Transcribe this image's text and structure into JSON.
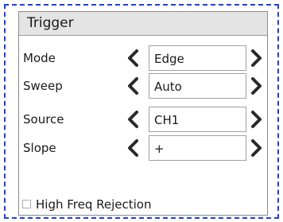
{
  "panel": {
    "title": "Trigger"
  },
  "rows": [
    {
      "label": "Mode",
      "value": "Edge"
    },
    {
      "label": "Sweep",
      "value": "Auto"
    },
    {
      "label": "Source",
      "value": "CH1"
    },
    {
      "label": "Slope",
      "value": "+"
    }
  ],
  "options": {
    "high_freq_rejection_label": "High Freq Rejection",
    "high_freq_rejection_checked": false
  },
  "icons": {
    "prev": "chevron-left-icon",
    "next": "chevron-right-icon"
  },
  "colors": {
    "frame_border": "#1f3fe0",
    "header_bg": "#e4e4e4",
    "arrow": "#2a2a2a"
  }
}
